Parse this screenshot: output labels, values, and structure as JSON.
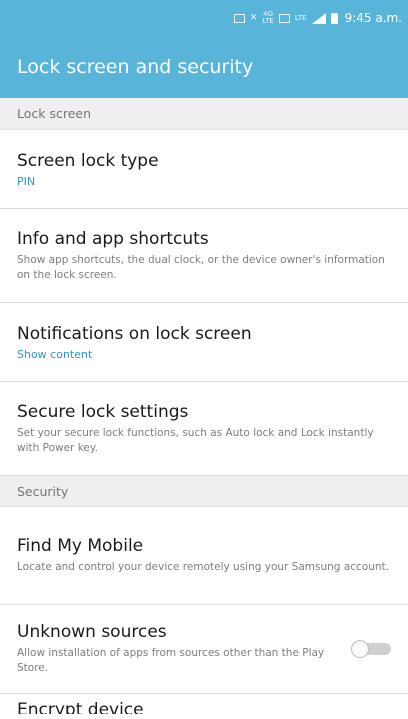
{
  "status_bar": {
    "time": "9:45 a.m.",
    "icons": [
      "screenshot-icon",
      "mute-icon",
      "4g-icon",
      "nfc-icon",
      "lte-icon",
      "signal-icon",
      "battery-icon"
    ]
  },
  "app_bar": {
    "title": "Lock screen and security"
  },
  "sections": {
    "lock_screen": {
      "header": "Lock screen",
      "items": [
        {
          "title": "Screen lock type",
          "value": "PIN"
        },
        {
          "title": "Info and app shortcuts",
          "desc": "Show app shortcuts, the dual clock, or the device owner's information on the lock screen."
        },
        {
          "title": "Notifications on lock screen",
          "value": "Show content"
        },
        {
          "title": "Secure lock settings",
          "desc": "Set your secure lock functions, such as Auto lock and Lock instantly with Power key."
        }
      ]
    },
    "security": {
      "header": "Security",
      "items": [
        {
          "title": "Find My Mobile",
          "desc": "Locate and control your device remotely using your Samsung account."
        },
        {
          "title": "Unknown sources",
          "desc": "Allow installation of apps from sources other than the Play Store.",
          "toggle": false
        }
      ],
      "partial_item": "Encrypt device"
    }
  },
  "colors": {
    "accent": "#58b4d9",
    "link": "#2f95c6"
  }
}
